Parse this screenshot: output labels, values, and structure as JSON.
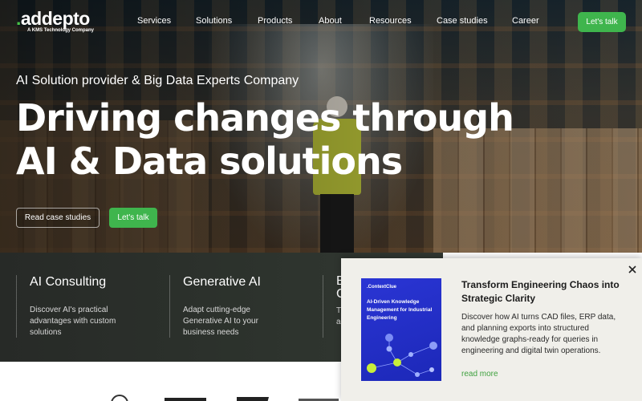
{
  "logo": {
    "dot": ".",
    "name": "addepto",
    "tagline": "A KMS Technology Company"
  },
  "nav": {
    "items": [
      {
        "label": "Services"
      },
      {
        "label": "Solutions"
      },
      {
        "label": "Products"
      },
      {
        "label": "About"
      },
      {
        "label": "Resources"
      },
      {
        "label": "Case studies"
      },
      {
        "label": "Career"
      }
    ],
    "cta_label": "Let's talk"
  },
  "hero": {
    "subtitle": "AI Solution provider & Big Data Experts Company",
    "title_line1": "Driving changes through",
    "title_line2": "AI & Data solutions",
    "btn_case_studies": "Read case studies",
    "btn_talk": "Let's talk"
  },
  "services": [
    {
      "title": "AI Consulting",
      "desc": "Discover AI's practical advantages with custom solutions"
    },
    {
      "title": "Generative AI",
      "desc": "Adapt cutting-edge Generative AI to your business needs"
    },
    {
      "title": "B\nC",
      "desc": "Tr\nac"
    }
  ],
  "popup": {
    "cover_brand": ".ContextClue",
    "cover_title": "AI-Driven Knowledge Management for Industrial Engineering",
    "title": "Transform Engineering Chaos into Strategic Clarity",
    "body": "Discover how AI turns CAD files, ERP data, and planning exports into structured knowledge graphs-ready for queries in engineering and digital twin operations.",
    "link": "read more",
    "close_icon": "close-icon"
  },
  "colors": {
    "accent": "#3fb54d",
    "link": "#3fa13f",
    "cover": "#2a35d4"
  }
}
